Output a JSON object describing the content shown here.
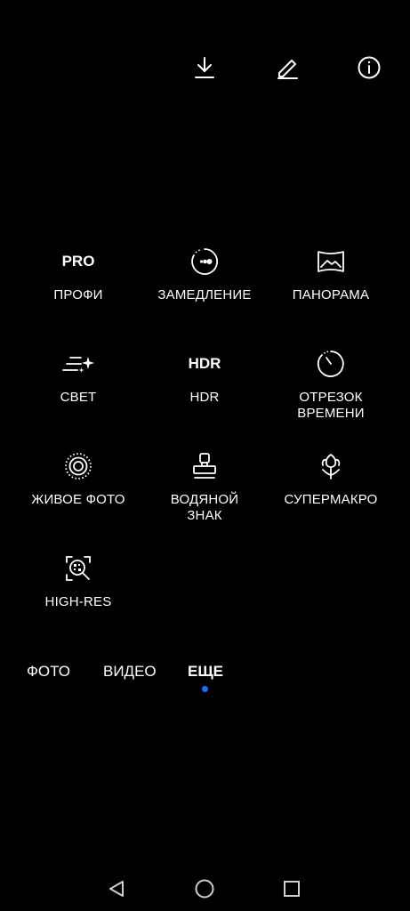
{
  "topbar": {
    "icons": [
      "download-icon",
      "edit-icon",
      "info-icon"
    ]
  },
  "modes": [
    {
      "icon_text": "PRO",
      "label": "ПРОФИ"
    },
    {
      "icon": "slow-motion-icon",
      "label": "ЗАМЕДЛЕНИЕ"
    },
    {
      "icon": "panorama-icon",
      "label": "ПАНОРАМА"
    },
    {
      "icon": "light-icon",
      "label": "СВЕТ"
    },
    {
      "icon_text": "HDR",
      "label": "HDR"
    },
    {
      "icon": "timelapse-icon",
      "label": "ОТРЕЗОК ВРЕМЕНИ"
    },
    {
      "icon": "live-photo-icon",
      "label": "ЖИВОЕ ФОТО"
    },
    {
      "icon": "watermark-icon",
      "label": "ВОДЯНОЙ ЗНАК"
    },
    {
      "icon": "super-macro-icon",
      "label": "СУПЕРМАКРО"
    },
    {
      "icon": "high-res-icon",
      "label": "HIGH-RES"
    }
  ],
  "tabs": [
    {
      "label": "ФОТО",
      "active": false
    },
    {
      "label": "ВИДЕО",
      "active": false
    },
    {
      "label": "ЕЩЕ",
      "active": true
    }
  ],
  "colors": {
    "background": "#000000",
    "text": "#ffffff",
    "accent": "#1f6fff"
  },
  "navbar": {
    "icons": [
      "back-icon",
      "home-icon",
      "recents-icon"
    ]
  }
}
